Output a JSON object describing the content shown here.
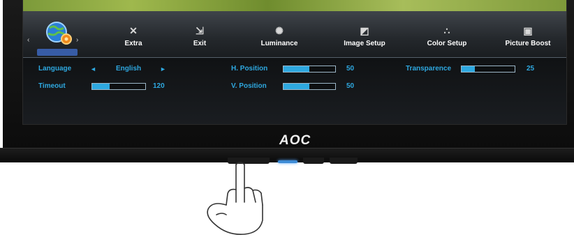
{
  "brand": "AOC",
  "colors": {
    "accent": "#2ea8e0",
    "bezel": "#0b0b0b",
    "osd_top": "#2f3439",
    "led": "#3e8cd6"
  },
  "menu": {
    "nav_left": "‹",
    "nav_right": "›",
    "items": [
      {
        "label": "Extra",
        "icon": "extra-icon"
      },
      {
        "label": "Exit",
        "icon": "exit-icon"
      },
      {
        "label": "Luminance",
        "icon": "luminance-icon"
      },
      {
        "label": "Image Setup",
        "icon": "image-setup-icon"
      },
      {
        "label": "Color Setup",
        "icon": "color-setup-icon"
      },
      {
        "label": "Picture Boost",
        "icon": "picture-boost-icon"
      }
    ]
  },
  "settings": {
    "language": {
      "label": "Language",
      "value": "English",
      "left_arrow": "◄",
      "right_arrow": "►"
    },
    "timeout": {
      "label": "Timeout",
      "value": "120",
      "level": 0.33
    },
    "h_position": {
      "label": "H. Position",
      "value": "50",
      "level": 0.5
    },
    "v_position": {
      "label": "V. Position",
      "value": "50",
      "level": 0.5
    },
    "transparence": {
      "label": "Transparence",
      "value": "25",
      "level": 0.25
    }
  }
}
